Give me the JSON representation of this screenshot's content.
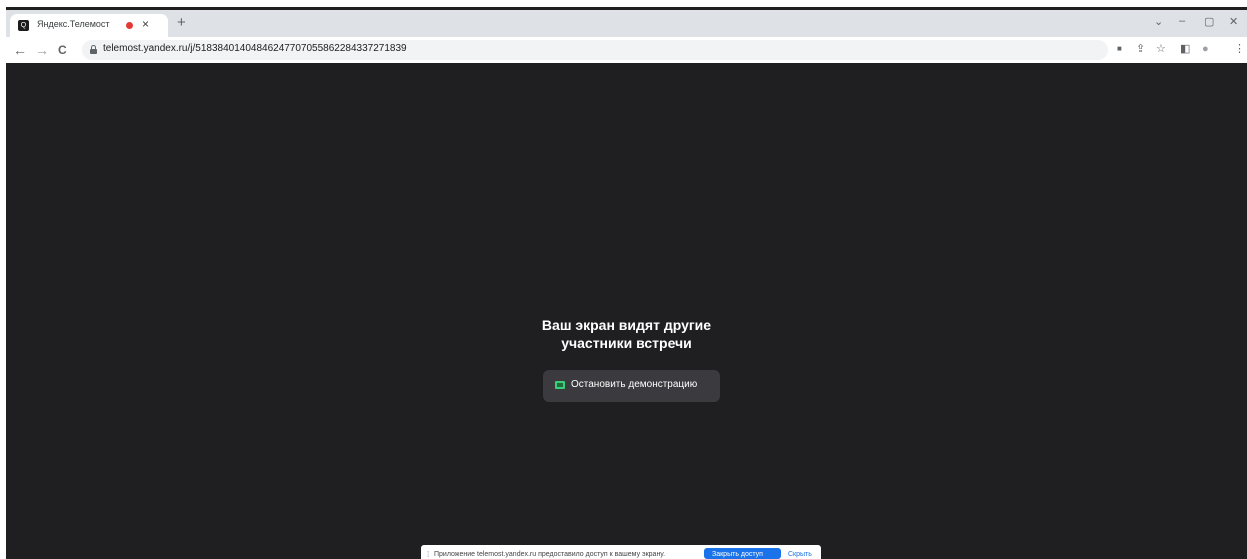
{
  "browser": {
    "tab": {
      "title": "Яндекс.Телемост",
      "favicon_text": "Q",
      "close_glyph": "×"
    },
    "new_tab_glyph": "+",
    "window_controls": {
      "dropdown": "⌄",
      "minimize": "–",
      "restore": "▢",
      "close": "✕"
    },
    "nav": {
      "back": "←",
      "forward": "→",
      "reload": "C"
    },
    "address": {
      "url": "telemost.yandex.ru/j/51838401404846247707055862284337271839"
    },
    "toolbar_icons": {
      "camera": "■",
      "share": "⇪",
      "bookmark": "☆",
      "sidepanel": "◧",
      "profile": "●",
      "menu": "⋮"
    }
  },
  "page": {
    "heading_line1": "Ваш экран видят другие",
    "heading_line2": "участники встречи",
    "stop_button_label": "Остановить демонстрацию"
  },
  "share_bar": {
    "grip": "⁞",
    "message": "Приложение telemost.yandex.ru предоставило доступ к вашему экрану.",
    "primary_label": "Закрыть доступ",
    "secondary_label": "Скрыть"
  },
  "colors": {
    "content_bg": "#1f1f22",
    "accent_green": "#3ad07a",
    "recording_red": "#e53935",
    "link_blue": "#1a73e8"
  }
}
